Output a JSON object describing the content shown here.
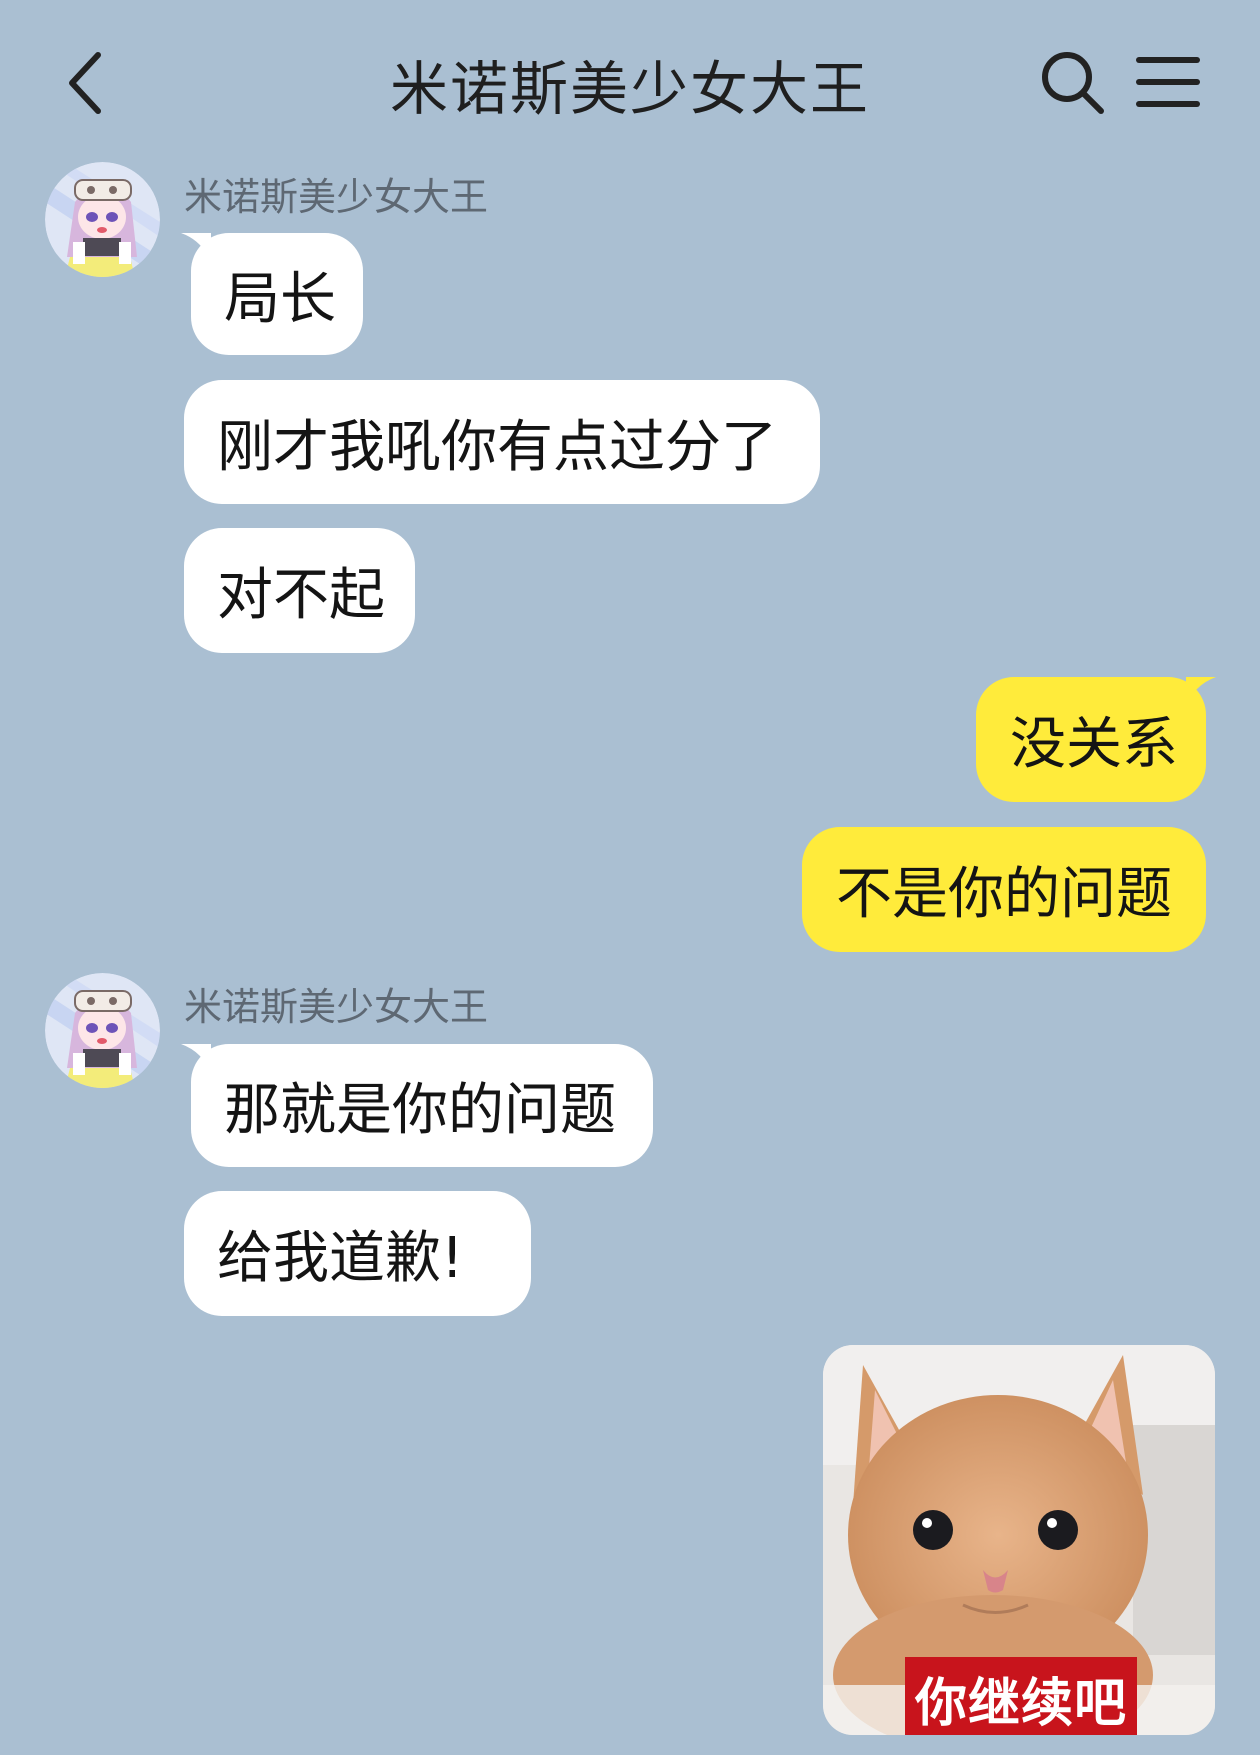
{
  "header": {
    "title": "米诺斯美少女大王",
    "back_icon": "chevron-left-icon",
    "search_icon": "search-icon",
    "menu_icon": "hamburger-menu-icon"
  },
  "messages": {
    "group1": {
      "sender": "米诺斯美少女大王",
      "texts": [
        "局长",
        "刚才我吼你有点过分了",
        "对不起"
      ]
    },
    "group2": {
      "texts": [
        "没关系",
        "不是你的问题"
      ]
    },
    "group3": {
      "sender": "米诺斯美少女大王",
      "texts": [
        "那就是你的问题",
        "给我道歉!"
      ]
    },
    "sticker": {
      "caption": "你继续吧",
      "icon": "kitten-sticker-image"
    }
  },
  "colors": {
    "background": "#aabfd2",
    "incoming_bubble": "#ffffff",
    "outgoing_bubble": "#ffeb3b",
    "caption_bg": "#c8141c"
  }
}
